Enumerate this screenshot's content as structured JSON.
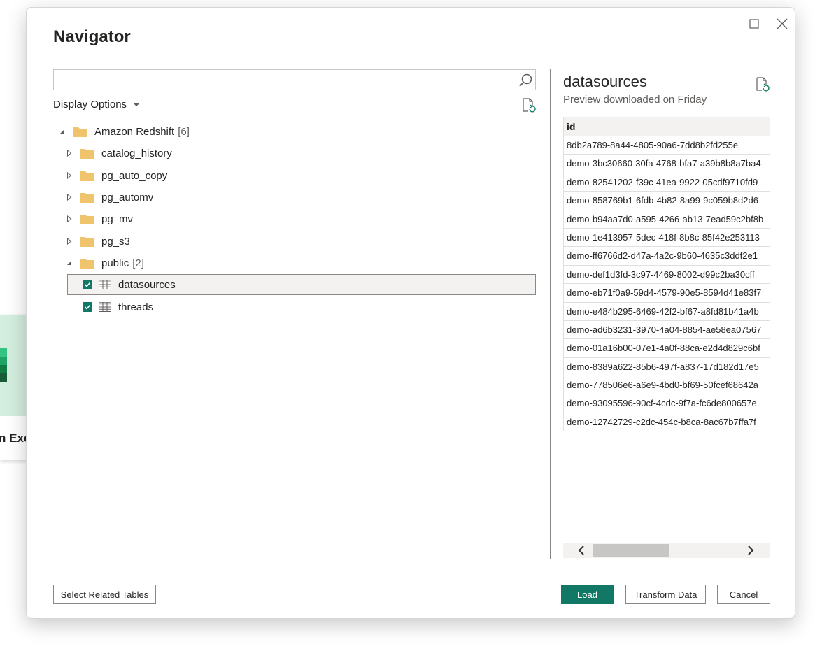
{
  "background_app": {
    "caption": "n Exc",
    "icon": "excel-icon"
  },
  "dialog": {
    "title": "Navigator",
    "maximize_icon": "maximize-icon",
    "close_icon": "close-icon",
    "search": {
      "value": "",
      "placeholder": "",
      "icon": "search-icon"
    },
    "display_options_label": "Display Options",
    "tree": {
      "root": {
        "label": "Amazon Redshift",
        "count": "[6]",
        "expanded": true
      },
      "schemas": [
        {
          "label": "catalog_history",
          "expanded": false
        },
        {
          "label": "pg_auto_copy",
          "expanded": false
        },
        {
          "label": "pg_automv",
          "expanded": false
        },
        {
          "label": "pg_mv",
          "expanded": false
        },
        {
          "label": "pg_s3",
          "expanded": false
        },
        {
          "label": "public",
          "count": "[2]",
          "expanded": true
        }
      ],
      "tables": [
        {
          "label": "datasources",
          "checked": true,
          "selected": true
        },
        {
          "label": "threads",
          "checked": true,
          "selected": false
        }
      ]
    },
    "preview": {
      "title": "datasources",
      "subtitle": "Preview downloaded on Friday",
      "column_header": "id",
      "rows": [
        "8db2a789-8a44-4805-90a6-7dd8b2fd255e",
        "demo-3bc30660-30fa-4768-bfa7-a39b8b8a7ba4",
        "demo-82541202-f39c-41ea-9922-05cdf9710fd9",
        "demo-858769b1-6fdb-4b82-8a99-9c059b8d2d6",
        "demo-b94aa7d0-a595-4266-ab13-7ead59c2bf8b",
        "demo-1e413957-5dec-418f-8b8c-85f42e253113",
        "demo-ff6766d2-d47a-4a2c-9b60-4635c3ddf2e1",
        "demo-def1d3fd-3c97-4469-8002-d99c2ba30cff",
        "demo-eb71f0a9-59d4-4579-90e5-8594d41e83f7",
        "demo-e484b295-6469-42f2-bf67-a8fd81b41a4b",
        "demo-ad6b3231-3970-4a04-8854-ae58ea07567",
        "demo-01a16b00-07e1-4a0f-88ca-e2d4d829c6bf",
        "demo-8389a622-85b6-497f-a837-17d182d17e5",
        "demo-778506e6-a6e9-4bd0-bf69-50fcef68642a",
        "demo-93095596-90cf-4cdc-9f7a-fc6de800657e",
        "demo-12742729-c2dc-454c-b8ca-8ac67b7ffa7f"
      ]
    },
    "buttons": {
      "select_related": "Select Related Tables",
      "load": "Load",
      "transform": "Transform Data",
      "cancel": "Cancel"
    },
    "colors": {
      "accent": "#117865",
      "folder": "#f0c36d",
      "border": "#8a8886"
    }
  }
}
